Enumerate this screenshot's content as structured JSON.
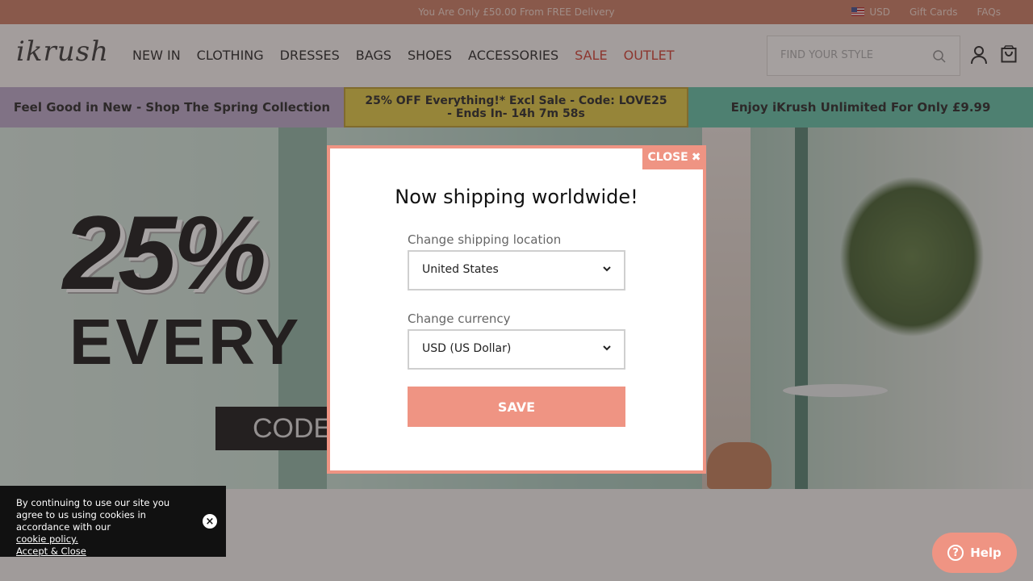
{
  "topbar": {
    "promo": "You Are Only £50.00 From FREE Delivery",
    "currency": "USD",
    "gift_cards": "Gift Cards",
    "faqs": "FAQs",
    "flag_icon": "us-flag-icon"
  },
  "header": {
    "logo": "ikrush",
    "nav": {
      "new_in": "NEW IN",
      "clothing": "CLOTHING",
      "dresses": "DRESSES",
      "bags": "BAGS",
      "shoes": "SHOES",
      "accessories": "ACCESSORIES",
      "sale": "SALE",
      "outlet": "OUTLET"
    },
    "search_placeholder": "FIND YOUR STYLE"
  },
  "strip": {
    "left": "Feel Good in New - Shop The Spring Collection",
    "middle": "25% OFF Everything!* Excl Sale - Code: LOVE25 - Ends In- 14h 7m 58s",
    "right": "Enjoy iKrush Unlimited For Only £9.99"
  },
  "hero": {
    "big_text": "25%",
    "every_text": "EVERY",
    "code_text": "CODE:"
  },
  "modal": {
    "close_label": "CLOSE",
    "title": "Now shipping worldwide!",
    "location_label": "Change shipping location",
    "location_value": "United States",
    "currency_label": "Change currency",
    "currency_value": "USD (US Dollar)",
    "save_label": "SAVE"
  },
  "cookie": {
    "text": "By continuing to use our site you agree to us using cookies in accordance with our",
    "policy_link": "cookie policy.",
    "accept_link": "Accept & Close"
  },
  "help": {
    "label": "Help"
  },
  "colors": {
    "topbar": "#c9785f",
    "accent": "#ef9483",
    "sale_red": "#d03a2c"
  }
}
